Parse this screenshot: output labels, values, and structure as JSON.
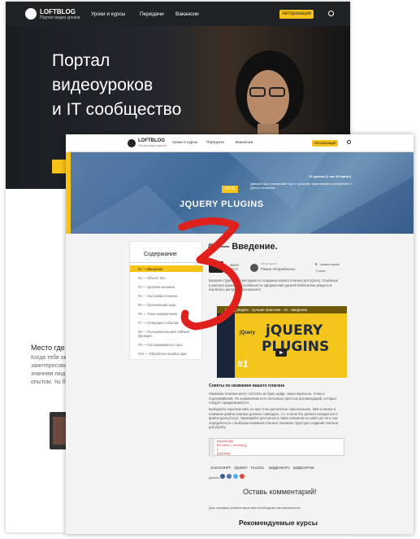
{
  "back": {
    "logo_title": "LOFTBLOG",
    "logo_sub": "Портал видео уроков",
    "nav": [
      "Уроки и курсы",
      "Передачи",
      "Вакансии"
    ],
    "auth_button": "Авторизация",
    "hero_lines": [
      "Портал",
      "видеоуроков",
      "и IT сообщество"
    ],
    "side_heading": "Место где",
    "side_lines": [
      "Когда тебя ок",
      "заинтересова",
      "знаниям людь",
      "опытом, ты бу"
    ]
  },
  "front": {
    "logo_title": "LOFTBLOG",
    "logo_sub": "Портал видео уроков",
    "nav": [
      "Уроки и курсы",
      "Передачи",
      "Вакансии"
    ],
    "auth_button": "Авторизация",
    "hero": {
      "badge": "КУРС",
      "title": "JQUERY PLUGINS",
      "lessons": "10 уроков (1 час 35 минут)",
      "desc": "Данный курс познакомит вас с лучшими практиками в разработке с jQuery плагинов."
    },
    "toc": {
      "heading": "Содержание",
      "items": [
        "#1 — Введение.",
        "#2 — Объект this.",
        "#3 — Цепочки вызовов.",
        "#4 — Настройки плагина.",
        "#5 — Организация кода.",
        "#6 — Темы оформления.",
        "#7 — Генерация событий.",
        "#8 — Пользовательские callback функции.",
        "#9 — Настраиваемость ajax.",
        "#10 — Обработка ошибок ajax."
      ]
    },
    "article": {
      "title": "#1 — Введение.",
      "date": "июля 2014",
      "author_role": "Автор урока",
      "author": "Роман Опарейченко",
      "comments_count": "0",
      "comments_label": "комментариев",
      "views_label": "0 views",
      "intro": "Базовая структура и методика по созданию нового плагина для jQuery. Основные и распространенные особенности оформления данной библиотеки увидеть и научитесь им профессионально!",
      "video_title": "jQuery plugins - лучшие практики - 01 - введение",
      "video_brand": "jQuery",
      "video_word1": "jQUERY",
      "video_word2": "PLUGINS",
      "video_num": "#1",
      "subheading": "Советы по названию вашего плагина",
      "para1": "Название плагина могут состоять из букв, цифр, знака переноса, точек и подчеркиваний. По знаменатию есть несколько простых рекомендаций, которых следует придерживаться:",
      "para2": "Выбирайте короткое имя, но при этом достаточно описательное. Имя плагина и название файла плагина должны совпадать, т.е. плагин foo должен находиться в файле jquery.foo.js. Проверяйте доступность имен плагинов на сайте до того, как определиться с выбором названия плагина. Базовая структура создания плагина для jQuery.",
      "code": [
        "(function($){",
        "  $.fn.test1 = function(){",
        "  };",
        "})(jQuery);"
      ],
      "tags": [
        "JAVASCRIPT",
        "JQUERY",
        "PLUGIN",
        "ВИДЕОКУРС",
        "ВИДЕОУРОК"
      ],
      "share_label": "Делись",
      "comments_heading": "Оставь комментарий!",
      "note": "Для отправки комментария вам необходимо авторизоваться.",
      "recommend": "Рекомендуемые курсы"
    }
  }
}
